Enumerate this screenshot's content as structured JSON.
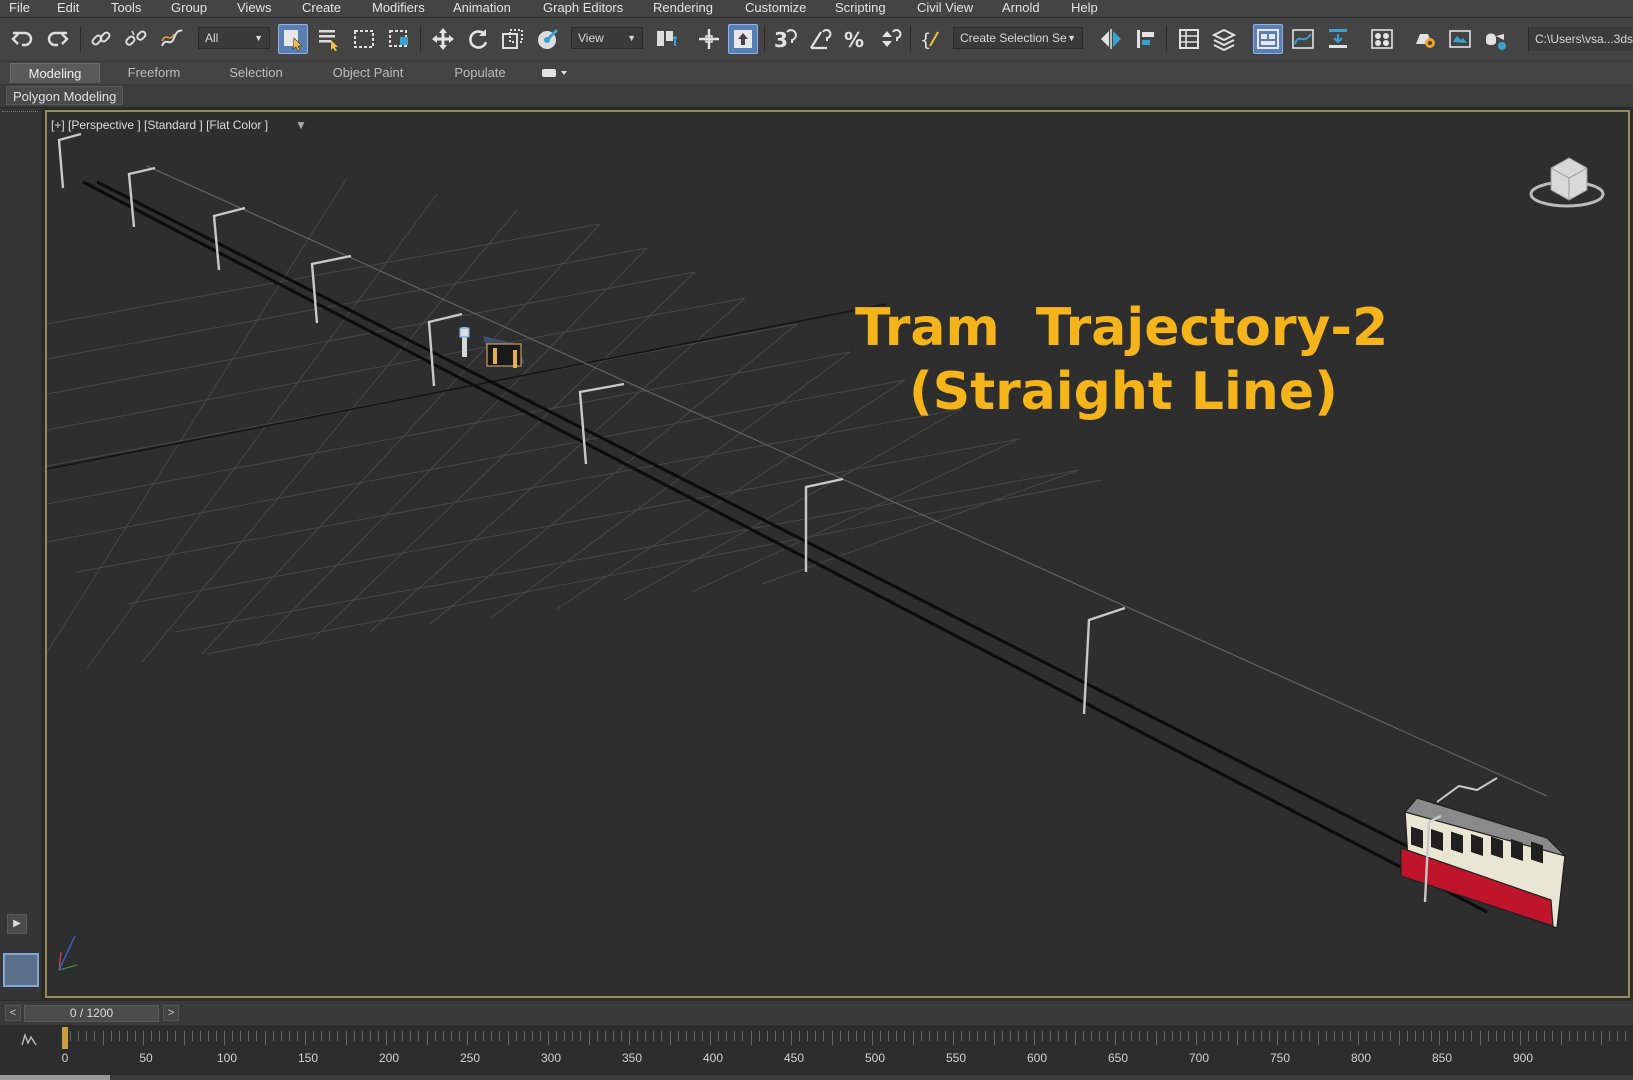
{
  "menu": {
    "items": [
      "File",
      "Edit",
      "Tools",
      "Group",
      "Views",
      "Create",
      "Modifiers",
      "Animation",
      "Graph Editors",
      "Rendering",
      "Customize",
      "Scripting",
      "Civil View",
      "Arnold",
      "Help"
    ]
  },
  "toolbar": {
    "selection_filter": "All",
    "reference_coord": "View",
    "named_selection": "Create Selection Se",
    "project_path": "C:\\Users\\vsa...3ds",
    "icons": [
      "undo-icon",
      "redo-icon",
      "link-icon",
      "unlink-icon",
      "bind-spacewarp-icon",
      "select-object-icon",
      "select-by-name-icon",
      "rect-selection-icon",
      "window-crossing-icon",
      "move-icon",
      "rotate-icon",
      "scale-icon",
      "placement-icon",
      "use-pivot-icon",
      "select-manipulate-icon",
      "keyboard-shortcut-toggle-icon",
      "snaps-toggle-icon",
      "angle-snap-icon",
      "percent-snap-icon",
      "spinner-snap-icon",
      "edit-named-selection-icon",
      "mirror-icon",
      "align-icon",
      "scene-explorer-icon",
      "layer-explorer-icon",
      "ribbon-toggle-icon",
      "curve-editor-icon",
      "schematic-view-icon",
      "material-editor-icon",
      "render-setup-icon",
      "rendered-frame-window-icon",
      "render-production-icon"
    ]
  },
  "ribbon": {
    "tabs": [
      "Modeling",
      "Freeform",
      "Selection",
      "Object Paint",
      "Populate"
    ],
    "active_tab": "Modeling",
    "sub_label": "Polygon Modeling"
  },
  "viewport": {
    "label": "[+] [Perspective ] [Standard ] [Flat Color ]",
    "overlay_title_line1": "Tram  Trajectory-2",
    "overlay_title_line2": "(Straight Line)",
    "border_color": "#9a8a55",
    "title_color": "#f4b41a"
  },
  "timeline": {
    "frame_display": "0 / 1200",
    "prev": "<",
    "next": ">",
    "ticks": [
      "0",
      "50",
      "100",
      "150",
      "200",
      "250",
      "300",
      "350",
      "400",
      "450",
      "500",
      "550",
      "600",
      "650",
      "700",
      "750",
      "800",
      "850",
      "900"
    ]
  }
}
